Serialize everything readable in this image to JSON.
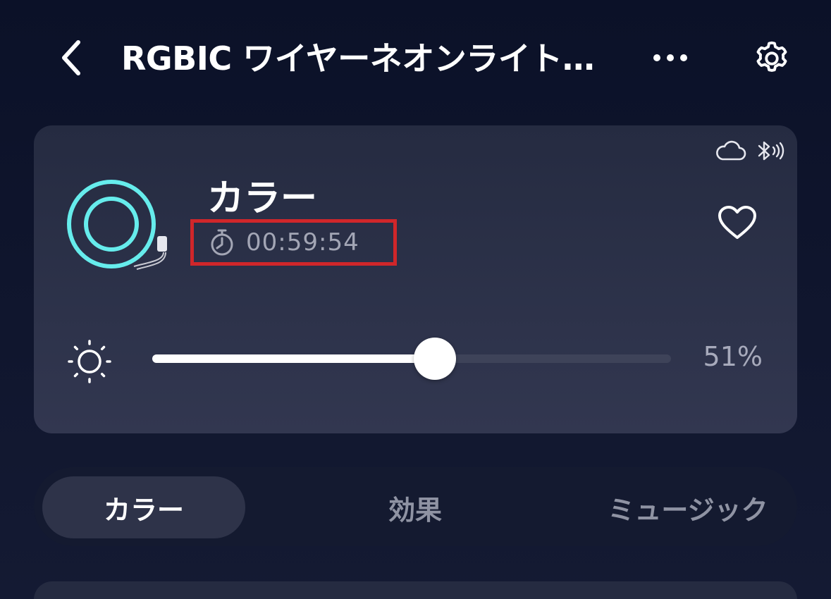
{
  "header": {
    "title": "RGBIC ワイヤーネオンライト…",
    "back_icon": "chevron-left-icon",
    "more_icon": "more-horizontal-icon",
    "settings_icon": "gear-icon"
  },
  "device": {
    "mode_title": "カラー",
    "timer": "00:59:54",
    "connection_icons": [
      "cloud-icon",
      "bluetooth-icon"
    ],
    "favorite_icon": "heart-icon",
    "brightness": {
      "value": 51,
      "label": "51%"
    },
    "highlight_color": "#d0262a",
    "device_accent_color": "#66ecec"
  },
  "tabs": [
    {
      "label": "カラー",
      "active": true
    },
    {
      "label": "効果",
      "active": false
    },
    {
      "label": "ミュージック",
      "active": false
    }
  ]
}
